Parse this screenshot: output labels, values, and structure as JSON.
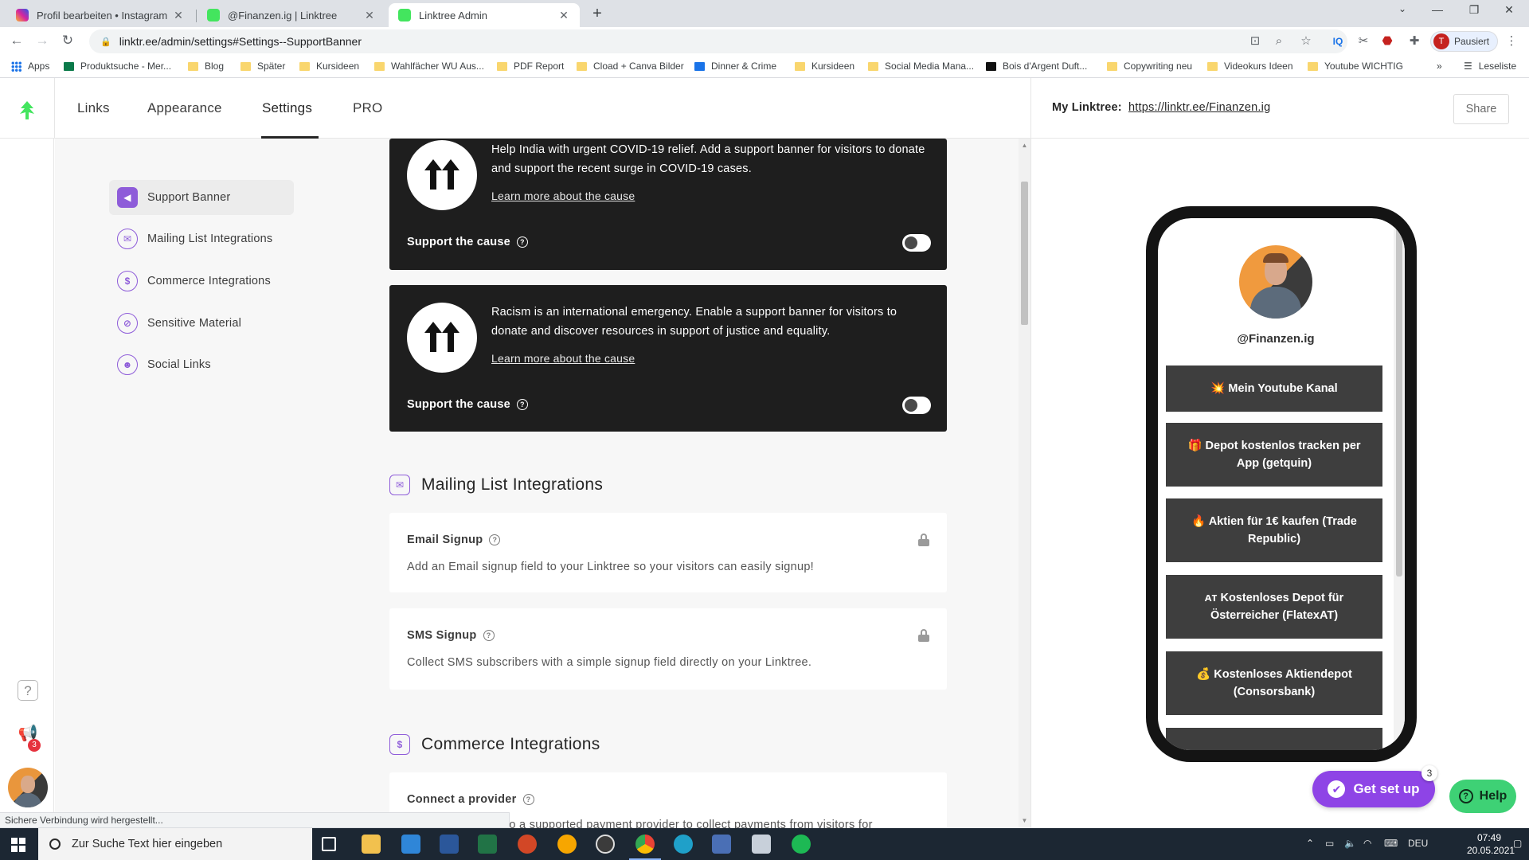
{
  "browser": {
    "tabs": [
      {
        "title": "Profil bearbeiten • Instagram",
        "favicon_color": "#d6249f",
        "active": false
      },
      {
        "title": "@Finanzen.ig | Linktree",
        "favicon_color": "#43e55e",
        "active": false
      },
      {
        "title": "Linktree Admin",
        "favicon_color": "#43e55e",
        "active": true
      }
    ],
    "url": "linktr.ee/admin/settings#Settings--SupportBanner",
    "profile_label": "Pausiert",
    "profile_initial": "T",
    "bookmarks": [
      "Apps",
      "Produktsuche - Mer...",
      "Blog",
      "Später",
      "Kursideen",
      "Wahlfächer WU Aus...",
      "PDF Report",
      "Cload + Canva Bilder",
      "Dinner & Crime",
      "Kursideen",
      "Social Media Mana...",
      "Bois d'Argent Duft...",
      "Copywriting neu",
      "Videokurs Ideen",
      "Youtube WICHTIG"
    ],
    "reading_list": "Leseliste",
    "status_text": "Sichere Verbindung wird hergestellt..."
  },
  "nav": {
    "tabs": [
      "Links",
      "Appearance",
      "Settings",
      "PRO"
    ],
    "active_tab": "Settings"
  },
  "rail": {
    "notification_count": "3"
  },
  "settings_menu": [
    {
      "label": "Support Banner",
      "icon": "megaphone-icon",
      "active": true
    },
    {
      "label": "Mailing List Integrations",
      "icon": "mail-icon",
      "active": false
    },
    {
      "label": "Commerce Integrations",
      "icon": "dollar-icon",
      "active": false
    },
    {
      "label": "Sensitive Material",
      "icon": "eye-slash-icon",
      "active": false
    },
    {
      "label": "Social Links",
      "icon": "smiley-icon",
      "active": false
    }
  ],
  "banners": [
    {
      "text": "Help India with urgent COVID-19 relief. Add a support banner for visitors to donate and support the recent surge in COVID-19 cases.",
      "link": "Learn more about the cause",
      "toggle_label": "Support the cause",
      "enabled": false
    },
    {
      "text": "Racism is an international emergency. Enable a support banner for visitors to donate and discover resources in support of justice and equality.",
      "link": "Learn more about the cause",
      "toggle_label": "Support the cause",
      "enabled": false
    }
  ],
  "mailing": {
    "title": "Mailing List Integrations",
    "email": {
      "title": "Email Signup",
      "desc": "Add an Email signup field to your Linktree so your visitors can easily signup!"
    },
    "sms": {
      "title": "SMS Signup",
      "desc": "Collect SMS subscribers with a simple signup field directly on your Linktree."
    }
  },
  "commerce": {
    "title": "Commerce Integrations",
    "provider_title": "Connect a provider",
    "provider_desc": "to a supported payment provider to collect payments from visitors for"
  },
  "preview": {
    "label": "My Linktree:",
    "url": "https://linktr.ee/Finanzen.ig",
    "share": "Share",
    "handle": "@Finanzen.ig",
    "links": [
      "💥 Mein Youtube Kanal",
      "🎁 Depot kostenlos tracken per App (getquin)",
      "🔥 Aktien für 1€ kaufen (Trade Republic)",
      "ᴀᴛ Kostenloses Depot für Österreicher (FlatexAT)",
      "💰 Kostenloses Aktiendepot (Consorsbank)"
    ]
  },
  "widgets": {
    "get_set_up": "Get set up",
    "get_set_up_badge": "3",
    "help": "Help"
  },
  "taskbar": {
    "search_placeholder": "Zur Suche Text hier eingeben",
    "language": "DEU",
    "time": "07:49",
    "date": "20.05.2021"
  }
}
